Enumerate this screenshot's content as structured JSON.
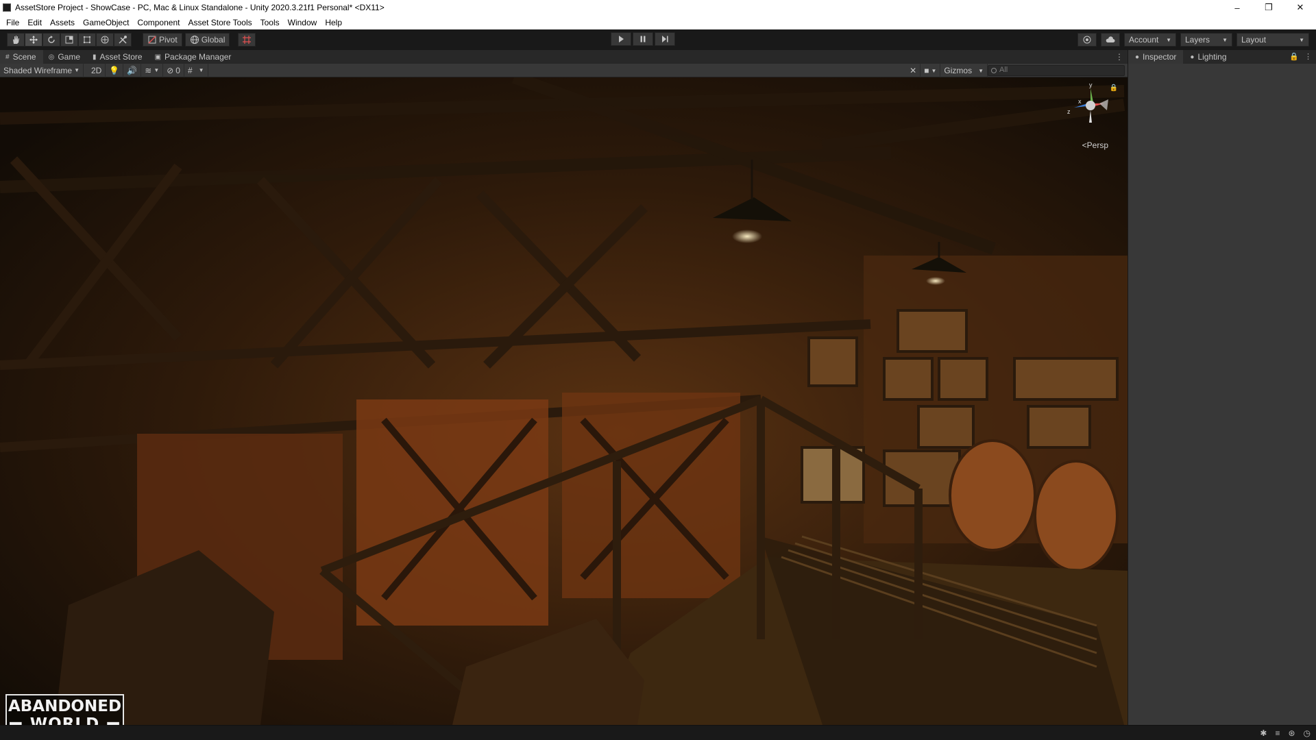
{
  "window": {
    "title": "AssetStore Project - ShowCase - PC, Mac & Linux Standalone - Unity 2020.3.21f1 Personal* <DX11>",
    "minimize": "–",
    "maximize": "❐",
    "close": "✕"
  },
  "menu": [
    "File",
    "Edit",
    "Assets",
    "GameObject",
    "Component",
    "Asset Store Tools",
    "Tools",
    "Window",
    "Help"
  ],
  "toolbar": {
    "pivot_label": "Pivot",
    "global_label": "Global",
    "account_label": "Account",
    "layers_label": "Layers",
    "layout_label": "Layout"
  },
  "tabs": [
    {
      "label": "Scene",
      "icon": "scene-icon"
    },
    {
      "label": "Game",
      "icon": "game-icon"
    },
    {
      "label": "Asset Store",
      "icon": "store-icon"
    },
    {
      "label": "Package Manager",
      "icon": "package-icon"
    }
  ],
  "scene_toolbar": {
    "draw_mode": "Shaded Wireframe",
    "mode_2d": "2D",
    "hidden_count": "0",
    "gizmos_label": "Gizmos",
    "search_placeholder": "All"
  },
  "scene": {
    "projection_label": "Persp",
    "gizmo_axes": {
      "x": "x",
      "y": "y",
      "z": "z"
    }
  },
  "logo": {
    "line1": "ABANDONED",
    "line2": "WORLD"
  },
  "inspector_tabs": [
    {
      "label": "Inspector",
      "icon": "info-icon"
    },
    {
      "label": "Lighting",
      "icon": "light-icon"
    }
  ],
  "colors": {
    "accent_dark": "#191919",
    "panel": "#383838",
    "scene_warm": "#7a3d16"
  }
}
